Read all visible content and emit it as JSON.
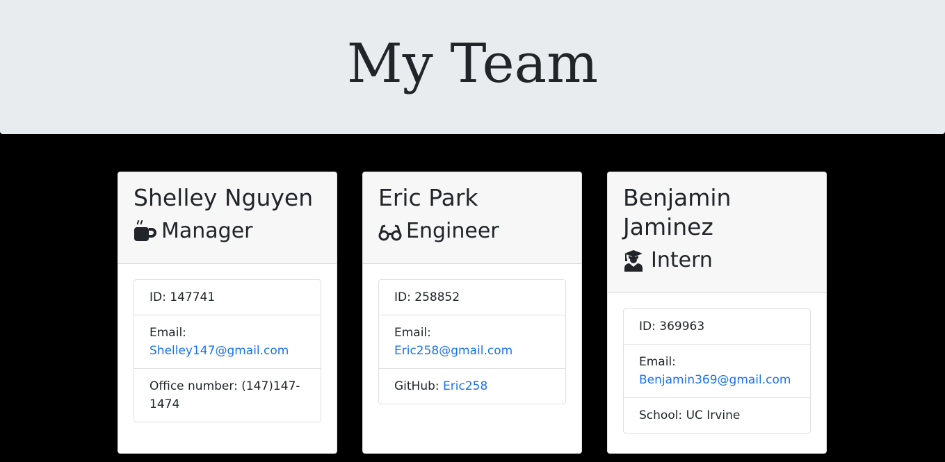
{
  "header": {
    "title": "My Team"
  },
  "colors": {
    "link": "#1a73e8",
    "jumbotron_bg": "#e9ecef",
    "page_bg": "#000000"
  },
  "team": [
    {
      "name": "Shelley Nguyen",
      "role": "Manager",
      "role_icon": "mug-icon",
      "id_label": "ID:",
      "id_value": "147741",
      "email_label": "Email:",
      "email_value": "Shelley147@gmail.com",
      "extra_label": "Office number:",
      "extra_value": "(147)147-1474"
    },
    {
      "name": "Eric Park",
      "role": "Engineer",
      "role_icon": "glasses-icon",
      "id_label": "ID:",
      "id_value": "258852",
      "email_label": "Email:",
      "email_value": "Eric258@gmail.com",
      "extra_label": "GitHub:",
      "extra_value": "Eric258"
    },
    {
      "name": "Benjamin Jaminez",
      "role": "Intern",
      "role_icon": "graduate-icon",
      "id_label": "ID:",
      "id_value": "369963",
      "email_label": "Email:",
      "email_value": "Benjamin369@gmail.com",
      "extra_label": "School:",
      "extra_value": "UC Irvine"
    }
  ]
}
